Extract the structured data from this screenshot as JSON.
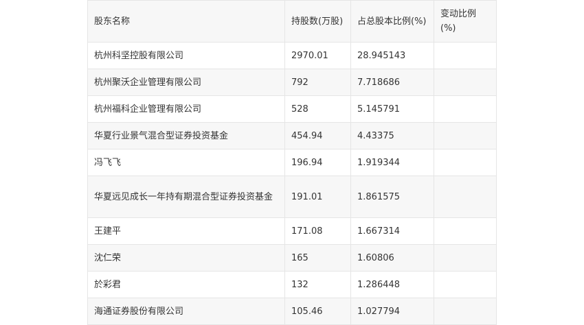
{
  "table": {
    "headers": [
      "股东名称",
      "持股数(万股)",
      "占总股本比例(%)",
      "变动比例(%)"
    ],
    "rows": [
      [
        "杭州科坚控股有限公司",
        "2970.01",
        "28.945143",
        ""
      ],
      [
        "杭州聚沃企业管理有限公司",
        "792",
        "7.718686",
        ""
      ],
      [
        "杭州福科企业管理有限公司",
        "528",
        "5.145791",
        ""
      ],
      [
        "华夏行业景气混合型证券投资基金",
        "454.94",
        "4.43375",
        ""
      ],
      [
        "冯飞飞",
        "196.94",
        "1.919344",
        ""
      ],
      [
        "华夏远见成长一年持有期混合型证券投资基金",
        "191.01",
        "1.861575",
        ""
      ],
      [
        "王建平",
        "171.08",
        "1.667314",
        ""
      ],
      [
        "沈仁荣",
        "165",
        "1.60806",
        ""
      ],
      [
        "於彩君",
        "132",
        "1.286448",
        ""
      ],
      [
        "海通证券股份有限公司",
        "105.46",
        "1.027794",
        ""
      ]
    ]
  }
}
